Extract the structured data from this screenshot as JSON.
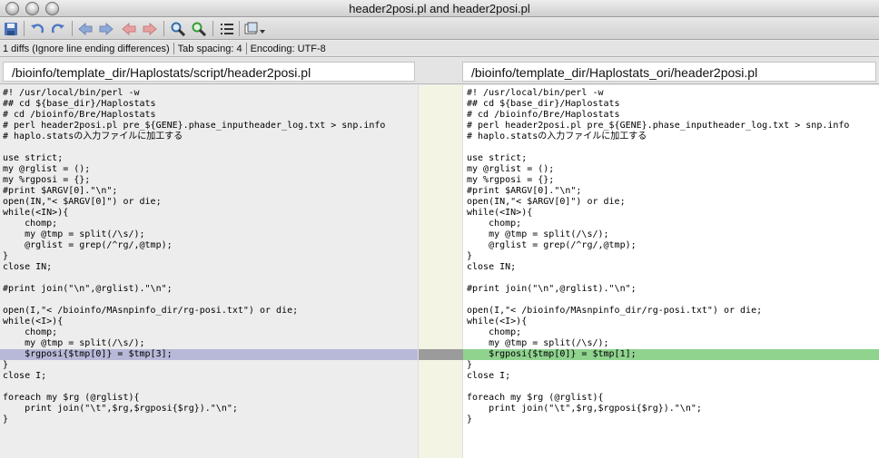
{
  "window": {
    "title": "header2posi.pl and header2posi.pl"
  },
  "toolbar": {
    "buttons": [
      {
        "name": "save-icon",
        "color": "#4a74b8"
      },
      {
        "name": "undo-icon",
        "color": "#4d78c2"
      },
      {
        "name": "redo-icon",
        "color": "#4d78c2"
      },
      {
        "name": "prev-diff-icon",
        "color": "#8fa9d6"
      },
      {
        "name": "next-diff-icon",
        "color": "#8fa9d6"
      },
      {
        "name": "first-diff-icon",
        "color": "#e7a0a0"
      },
      {
        "name": "last-diff-icon",
        "color": "#e7a0a0"
      },
      {
        "name": "find-icon",
        "color": "#2f6fa8"
      },
      {
        "name": "find-replace-icon",
        "color": "#3a9a3a"
      },
      {
        "name": "line-numbers-icon",
        "color": "#333333"
      },
      {
        "name": "options-menu-icon",
        "color": "#555555"
      }
    ]
  },
  "status": {
    "diffs": "1 diffs (Ignore line ending differences)",
    "tab_spacing": "Tab spacing: 4",
    "encoding": "Encoding: UTF-8"
  },
  "paths": {
    "left": "/bioinfo/template_dir/Haplostats/script/header2posi.pl",
    "right": "/bioinfo/template_dir/Haplostats_ori/header2posi.pl"
  },
  "colors": {
    "left_highlight": "#b8b8d8",
    "right_highlight": "#8fd38f",
    "gutter_mark": "#9b9b9b"
  },
  "left_code": [
    "#! /usr/local/bin/perl -w",
    "## cd ${base_dir}/Haplostats",
    "# cd /bioinfo/Bre/Haplostats",
    "# perl header2posi.pl pre_${GENE}.phase_inputheader_log.txt > snp.info",
    "# haplo.statsの入力ファイルに加工する",
    "",
    "use strict;",
    "my @rglist = ();",
    "my %rgposi = {};",
    "#print $ARGV[0].\"\\n\";",
    "open(IN,\"< $ARGV[0]\") or die;",
    "while(<IN>){",
    "    chomp;",
    "    my @tmp = split(/\\s/);",
    "    @rglist = grep(/^rg/,@tmp);",
    "}",
    "close IN;",
    "",
    "#print join(\"\\n\",@rglist).\"\\n\";",
    "",
    "open(I,\"< /bioinfo/MAsnpinfo_dir/rg-posi.txt\") or die;",
    "while(<I>){",
    "    chomp;",
    "    my @tmp = split(/\\s/);",
    "    $rgposi{$tmp[0]} = $tmp[3];",
    "}",
    "close I;",
    "",
    "foreach my $rg (@rglist){",
    "    print join(\"\\t\",$rg,$rgposi{$rg}).\"\\n\";",
    "}"
  ],
  "right_code": [
    "#! /usr/local/bin/perl -w",
    "## cd ${base_dir}/Haplostats",
    "# cd /bioinfo/Bre/Haplostats",
    "# perl header2posi.pl pre_${GENE}.phase_inputheader_log.txt > snp.info",
    "# haplo.statsの入力ファイルに加工する",
    "",
    "use strict;",
    "my @rglist = ();",
    "my %rgposi = {};",
    "#print $ARGV[0].\"\\n\";",
    "open(IN,\"< $ARGV[0]\") or die;",
    "while(<IN>){",
    "    chomp;",
    "    my @tmp = split(/\\s/);",
    "    @rglist = grep(/^rg/,@tmp);",
    "}",
    "close IN;",
    "",
    "#print join(\"\\n\",@rglist).\"\\n\";",
    "",
    "open(I,\"< /bioinfo/MAsnpinfo_dir/rg-posi.txt\") or die;",
    "while(<I>){",
    "    chomp;",
    "    my @tmp = split(/\\s/);",
    "    $rgposi{$tmp[0]} = $tmp[1];",
    "}",
    "close I;",
    "",
    "foreach my $rg (@rglist){",
    "    print join(\"\\t\",$rg,$rgposi{$rg}).\"\\n\";",
    "}"
  ],
  "diff_line_index": 24
}
